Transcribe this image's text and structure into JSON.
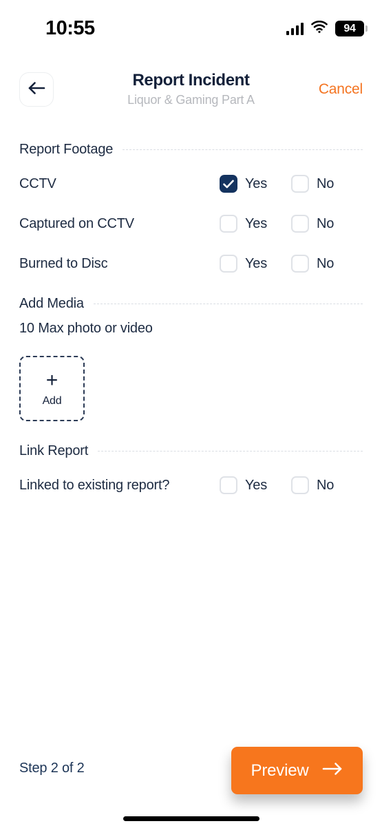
{
  "status_bar": {
    "time": "10:55",
    "battery_level": "94",
    "signal_icon": "cellular-signal-icon",
    "wifi_icon": "wifi-icon",
    "battery_icon": "battery-icon"
  },
  "header": {
    "back_icon": "arrow-left-icon",
    "title": "Report Incident",
    "subtitle": "Liquor & Gaming Part A",
    "cancel_label": "Cancel"
  },
  "sections": {
    "report_footage": {
      "title": "Report Footage",
      "rows": [
        {
          "label": "CCTV",
          "yes_label": "Yes",
          "no_label": "No",
          "selected": "yes"
        },
        {
          "label": "Captured on CCTV",
          "yes_label": "Yes",
          "no_label": "No",
          "selected": "none"
        },
        {
          "label": "Burned to Disc",
          "yes_label": "Yes",
          "no_label": "No",
          "selected": "none"
        }
      ]
    },
    "add_media": {
      "title": "Add Media",
      "note": "10 Max photo or video",
      "add_icon": "plus-icon",
      "add_label": "Add"
    },
    "link_report": {
      "title": "Link Report",
      "rows": [
        {
          "label": "Linked to existing report?",
          "yes_label": "Yes",
          "no_label": "No",
          "selected": "none"
        }
      ]
    }
  },
  "footer": {
    "step_text": "Step 2 of 2",
    "preview_label": "Preview",
    "preview_icon": "arrow-right-icon"
  },
  "colors": {
    "accent_orange": "#f7761d",
    "checked_navy": "#14335f",
    "text_navy": "#1d2b42",
    "subtitle_gray": "#b6b8bd"
  }
}
